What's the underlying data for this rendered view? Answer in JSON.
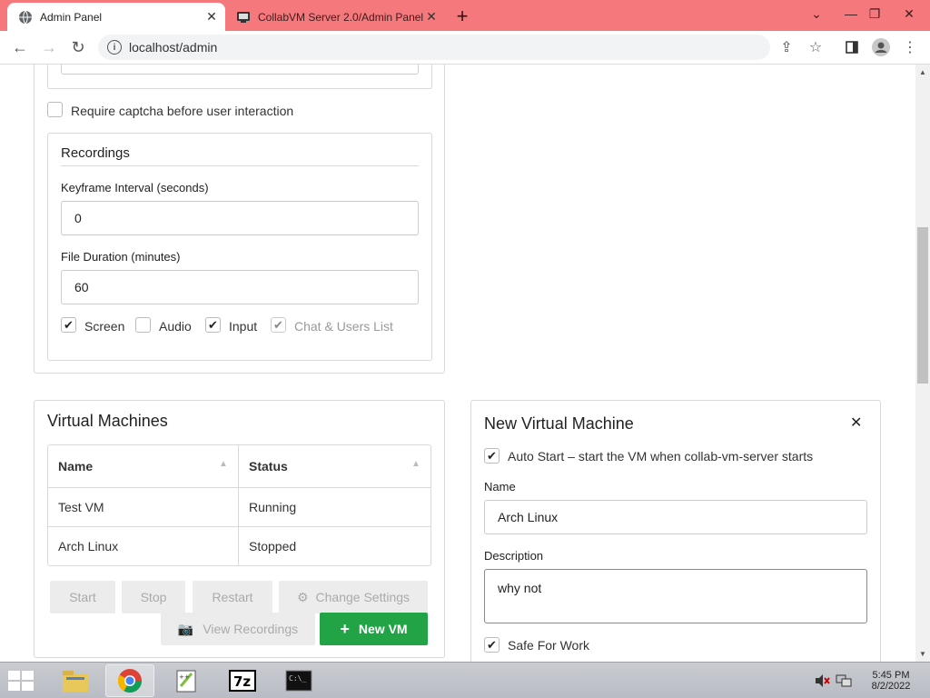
{
  "browser": {
    "tabs": [
      {
        "title": "Admin Panel"
      },
      {
        "title": "CollabVM Server 2.0/Admin Panel"
      }
    ],
    "url": "localhost/admin"
  },
  "settings": {
    "captcha_label": "Require captcha before user interaction",
    "captcha_checked": false,
    "recordings": {
      "heading": "Recordings",
      "keyframe_label": "Keyframe Interval (seconds)",
      "keyframe_value": "0",
      "duration_label": "File Duration (minutes)",
      "duration_value": "60",
      "options": [
        {
          "label": "Screen",
          "checked": true,
          "disabled": false
        },
        {
          "label": "Audio",
          "checked": false,
          "disabled": false
        },
        {
          "label": "Input",
          "checked": true,
          "disabled": false
        },
        {
          "label": "Chat & Users List",
          "checked": true,
          "disabled": true
        }
      ]
    }
  },
  "vms": {
    "heading": "Virtual Machines",
    "columns": [
      "Name",
      "Status"
    ],
    "rows": [
      {
        "name": "Test VM",
        "status": "Running"
      },
      {
        "name": "Arch Linux",
        "status": "Stopped"
      }
    ],
    "buttons": {
      "start": "Start",
      "stop": "Stop",
      "restart": "Restart",
      "change_settings": "Change Settings",
      "view_recordings": "View Recordings",
      "new_vm": "New VM"
    }
  },
  "new_vm": {
    "heading": "New Virtual Machine",
    "auto_start_label": "Auto Start – start the VM when collab-vm-server starts",
    "auto_start_checked": true,
    "name_label": "Name",
    "name_value": "Arch Linux",
    "description_label": "Description",
    "description_value": "why not",
    "sfw_label": "Safe For Work",
    "sfw_checked": true
  },
  "taskbar": {
    "time": "5:45 PM",
    "date": "8/2/2022"
  },
  "colors": {
    "tab_strip": "#f4787c",
    "primary_button": "#21a346"
  }
}
